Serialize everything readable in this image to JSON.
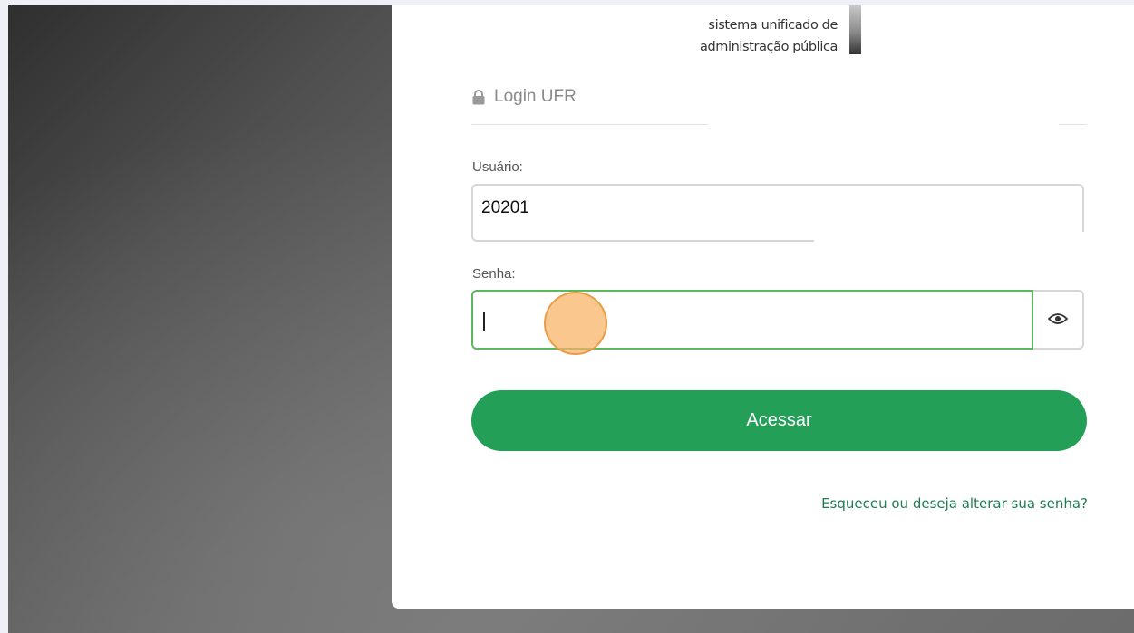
{
  "brand": {
    "line1": "sistema unificado de",
    "line2": "administração pública"
  },
  "login": {
    "title": "Login UFR",
    "title_icon": "lock-icon",
    "username_label": "Usuário:",
    "username_value": "20201",
    "password_label": "Senha:",
    "password_value": "",
    "toggle_icon": "eye-icon",
    "submit_label": "Acessar",
    "forgot_link": "Esqueceu ou deseja alterar sua senha?"
  },
  "colors": {
    "primary": "#239f57",
    "focus_border": "#5cb85c",
    "link": "#1e7d50",
    "click_indicator": "#f8b262"
  }
}
